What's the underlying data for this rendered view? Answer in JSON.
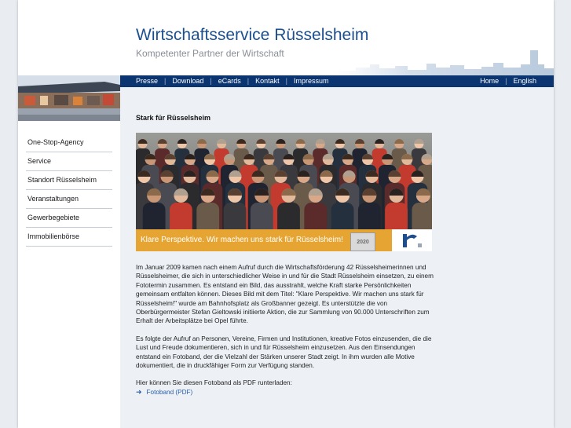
{
  "header": {
    "title": "Wirtschaftsservice Rüsselsheim",
    "subtitle": "Kompetenter Partner der Wirtschaft"
  },
  "nav": {
    "left": [
      "Presse",
      "Download",
      "eCards",
      "Kontakt",
      "Impressum"
    ],
    "right": [
      "Home",
      "English"
    ],
    "separator": "|"
  },
  "sidebar": {
    "items": [
      "One-Stop-Agency",
      "Service",
      "Standort Rüsselsheim",
      "Veranstaltungen",
      "Gewerbegebiete",
      "Immobilienbörse"
    ]
  },
  "content": {
    "title": "Stark für Rüsselsheim",
    "banner_slogan": "Klare Perspektive. Wir machen uns stark für Rüsselsheim!",
    "banner_badge": "2020",
    "paragraph1": "Im Januar 2009 kamen nach einem Aufruf durch die Wirtschaftsförderung 42 Rüsselsheimerinnen und Rüsselsheimer, die sich in unterschiedlicher Weise in und für die Stadt Rüsselsheim einsetzen, zu einem Fototermin zusammen. Es entstand ein Bild, das ausstrahlt, welche Kraft starke Persönlichkeiten gemeinsam entfalten können. Dieses Bild mit dem Titel: \"Klare Perspektive. Wir machen uns stark für Rüsselsheim!\" wurde am Bahnhofsplatz als Großbanner gezeigt. Es unterstützte die von Oberbürgermeister Stefan Gieltowski initiierte Aktion, die zur Sammlung von 90.000 Unterschriften zum Erhalt der Arbeitsplätze bei Opel führte.",
    "paragraph2": "Es folgte der Aufruf an Personen, Vereine, Firmen und Institutionen, kreative Fotos einzusenden, die die Lust und Freude dokumentieren, sich in und für Rüsselsheim einzusetzen. Aus den Einsendungen entstand ein Fotoband, der die Vielzahl der Stärken unserer Stadt zeigt. In ihm wurden alle Motive dokumentiert, die in druckfähiger Form zur Verfügung standen.",
    "download_intro": "Hier können Sie diesen Fotoband als PDF runterladen:",
    "download_link": "Fotoband (PDF)",
    "link_icon": "arrow-right-icon"
  },
  "colors": {
    "brand_blue": "#1d4f8f",
    "nav_bg": "#0b3571",
    "banner_orange": "#e6a532",
    "content_bg": "#edf1f6"
  }
}
